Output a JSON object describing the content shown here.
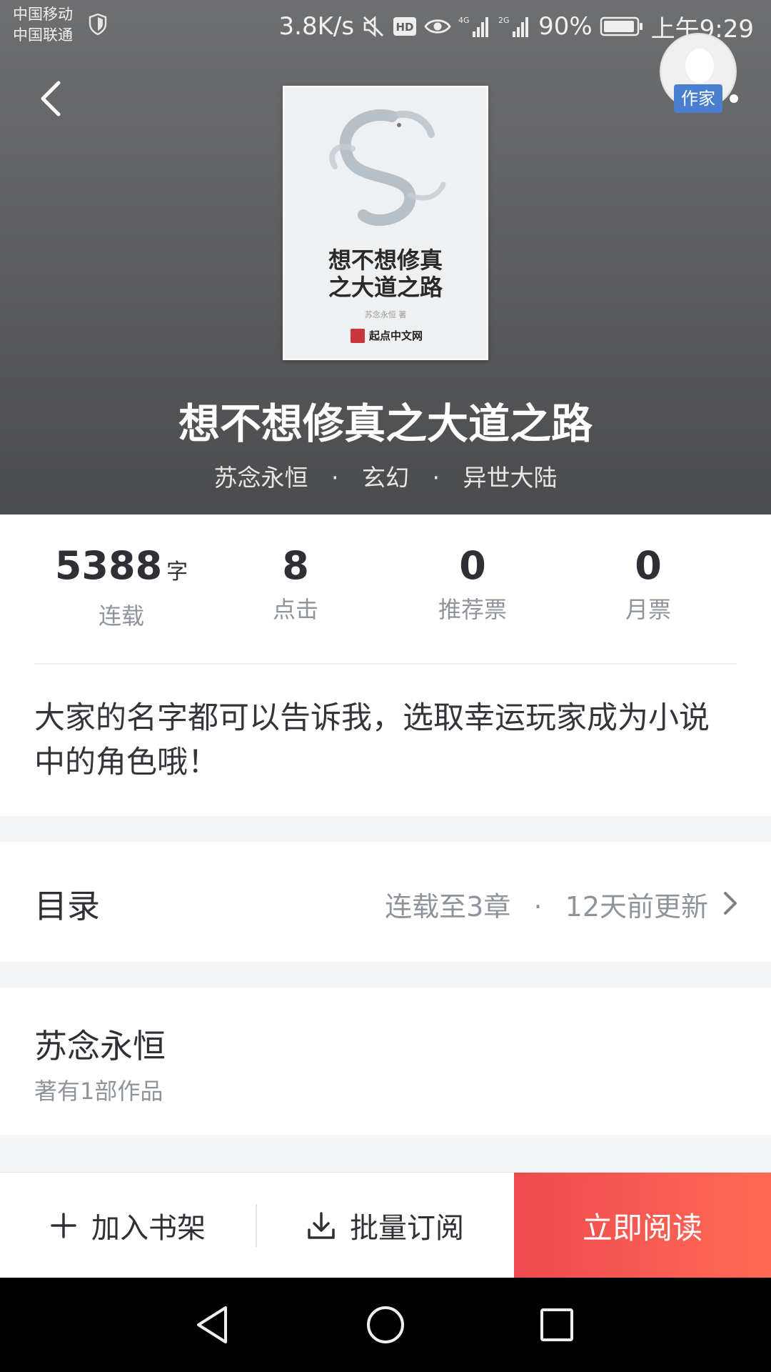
{
  "status_bar": {
    "carrier_1": "中国移动",
    "carrier_2": "中国联通",
    "net_speed": "3.8K/s",
    "network_1": "4G",
    "network_2": "2G",
    "battery": "90%",
    "time": "上午9:29"
  },
  "book": {
    "cover_title_line1": "想不想修真",
    "cover_title_line2": "之大道之路",
    "cover_author": "苏念永恒 著",
    "cover_brand": "起点中文网",
    "title": "想不想修真之大道之路",
    "author": "苏念永恒",
    "category": "玄幻",
    "subcategory": "异世大陆",
    "meta_separator": "·"
  },
  "stats": [
    {
      "value": "5388",
      "unit": "字",
      "label": "连载"
    },
    {
      "value": "8",
      "unit": "",
      "label": "点击"
    },
    {
      "value": "0",
      "unit": "",
      "label": "推荐票"
    },
    {
      "value": "0",
      "unit": "",
      "label": "月票"
    }
  ],
  "intro": "大家的名字都可以告诉我，选取幸运玩家成为小说中的角色哦！",
  "toc": {
    "label": "目录",
    "status": "连载至3章",
    "separator": "·",
    "updated": "12天前更新"
  },
  "author_card": {
    "name": "苏念永恒",
    "works": "著有1部作品",
    "badge": "作家"
  },
  "actions": {
    "add_shelf": "加入书架",
    "batch_subscribe": "批量订阅",
    "read_now": "立即阅读"
  },
  "colors": {
    "read_button_start": "#ee4a4f",
    "read_button_end": "#ff6a55",
    "badge_blue": "#4a7fd0"
  }
}
